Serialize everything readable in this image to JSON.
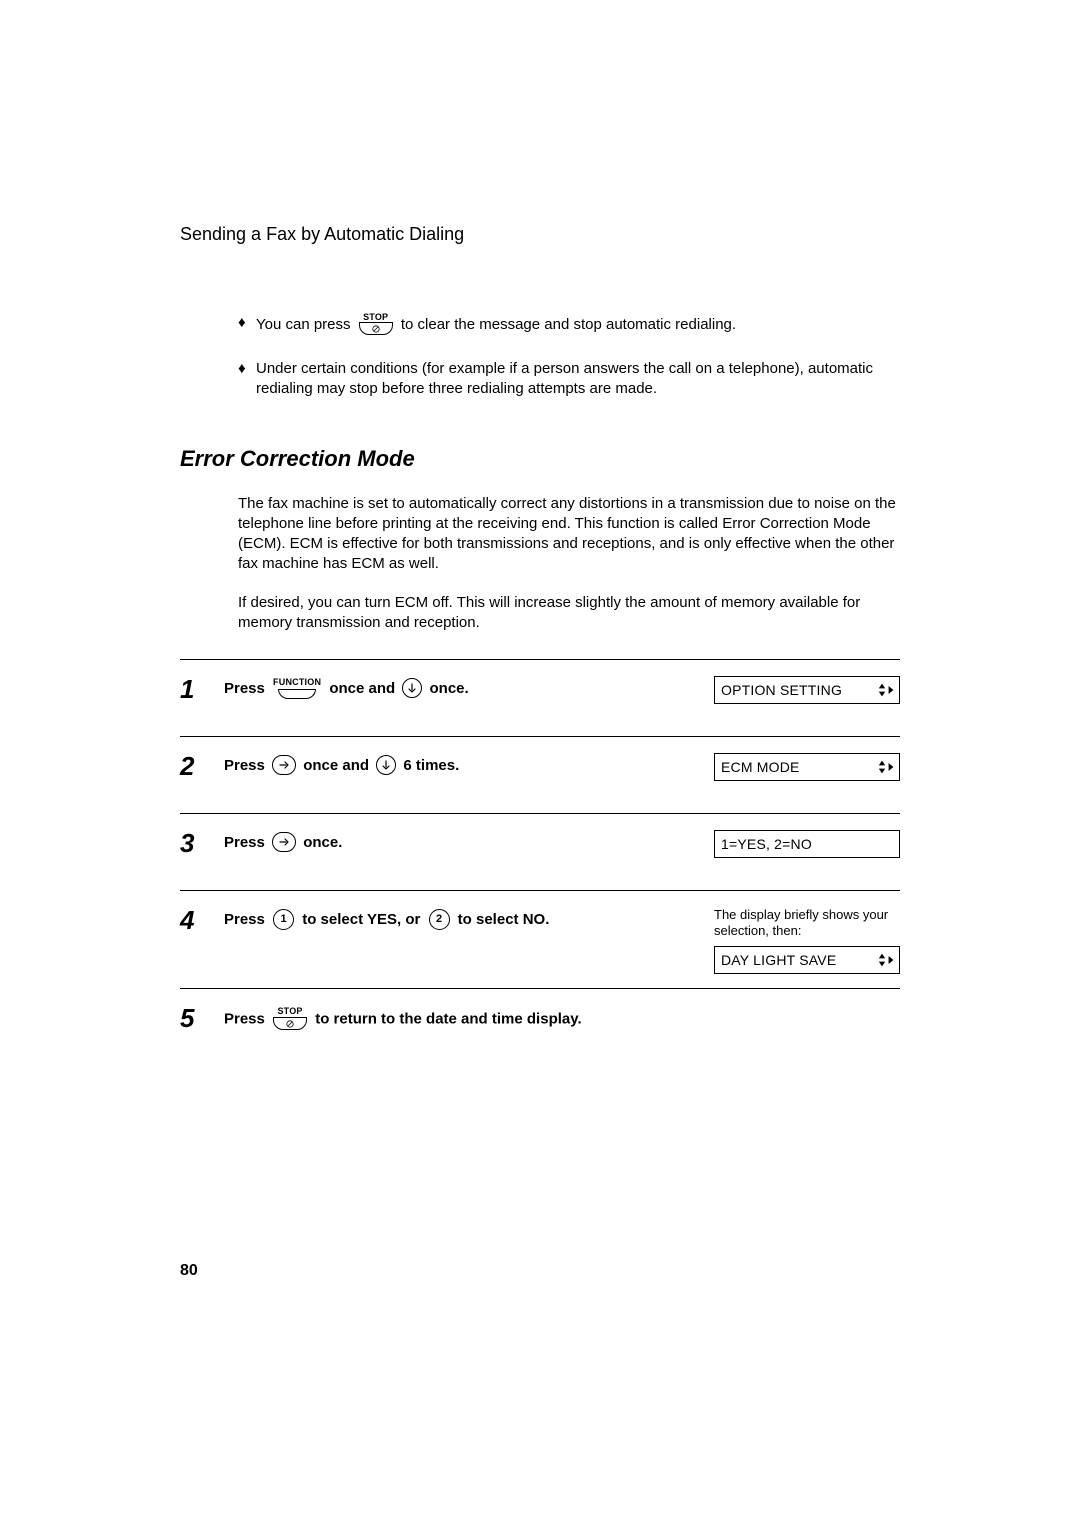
{
  "header": "Sending a Fax by Automatic Dialing",
  "bullets": {
    "b1_a": "You can press ",
    "b1_b": " to clear the message and stop automatic redialing.",
    "b2": "Under certain conditions (for example if a person answers the call on a telephone), automatic redialing may stop before three redialing attempts are made."
  },
  "section": {
    "title": "Error Correction Mode",
    "p1": "The fax machine is set to automatically correct any distortions in a transmission due to noise on the telephone line before printing at the receiving end. This function is called Error Correction Mode (ECM). ECM is effective for both transmissions and receptions, and is only effective when the other fax machine has ECM as well.",
    "p2": "If desired, you can turn ECM off. This will increase slightly the amount of memory available for memory transmission and reception."
  },
  "keys": {
    "stop": "STOP",
    "function": "FUNCTION",
    "one": "1",
    "two": "2"
  },
  "steps": {
    "s1": {
      "num": "1",
      "a": "Press ",
      "b": " once and ",
      "c": " once."
    },
    "s2": {
      "num": "2",
      "a": "Press ",
      "b": " once and ",
      "c": " 6 times."
    },
    "s3": {
      "num": "3",
      "a": "Press ",
      "b": " once."
    },
    "s4": {
      "num": "4",
      "a": "Press ",
      "b": " to select YES, or ",
      "c": " to select NO."
    },
    "s5": {
      "num": "5",
      "a": "Press ",
      "b": " to return to the date and time display."
    }
  },
  "lcd": {
    "s1": "OPTION SETTING",
    "s2": "ECM MODE",
    "s3": "1=YES, 2=NO",
    "s4_note": "The display briefly shows your selection, then:",
    "s4": "DAY LIGHT SAVE"
  },
  "page_number": "80"
}
